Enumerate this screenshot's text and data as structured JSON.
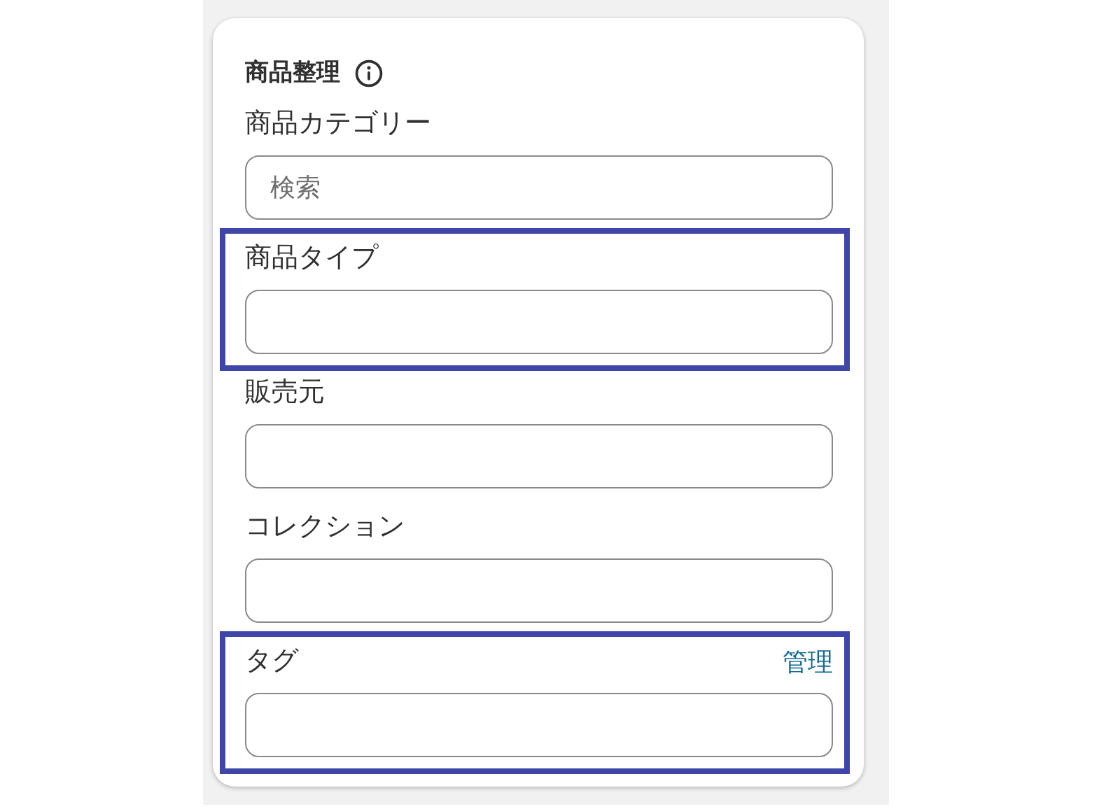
{
  "card": {
    "title": "商品整理",
    "fields": [
      {
        "label": "商品カテゴリー",
        "placeholder": "検索",
        "highlighted": false
      },
      {
        "label": "商品タイプ",
        "highlighted": true
      },
      {
        "label": "販売元",
        "highlighted": false
      },
      {
        "label": "コレクション",
        "highlighted": false
      },
      {
        "label": "タグ",
        "action": "管理",
        "highlighted": true
      }
    ]
  }
}
